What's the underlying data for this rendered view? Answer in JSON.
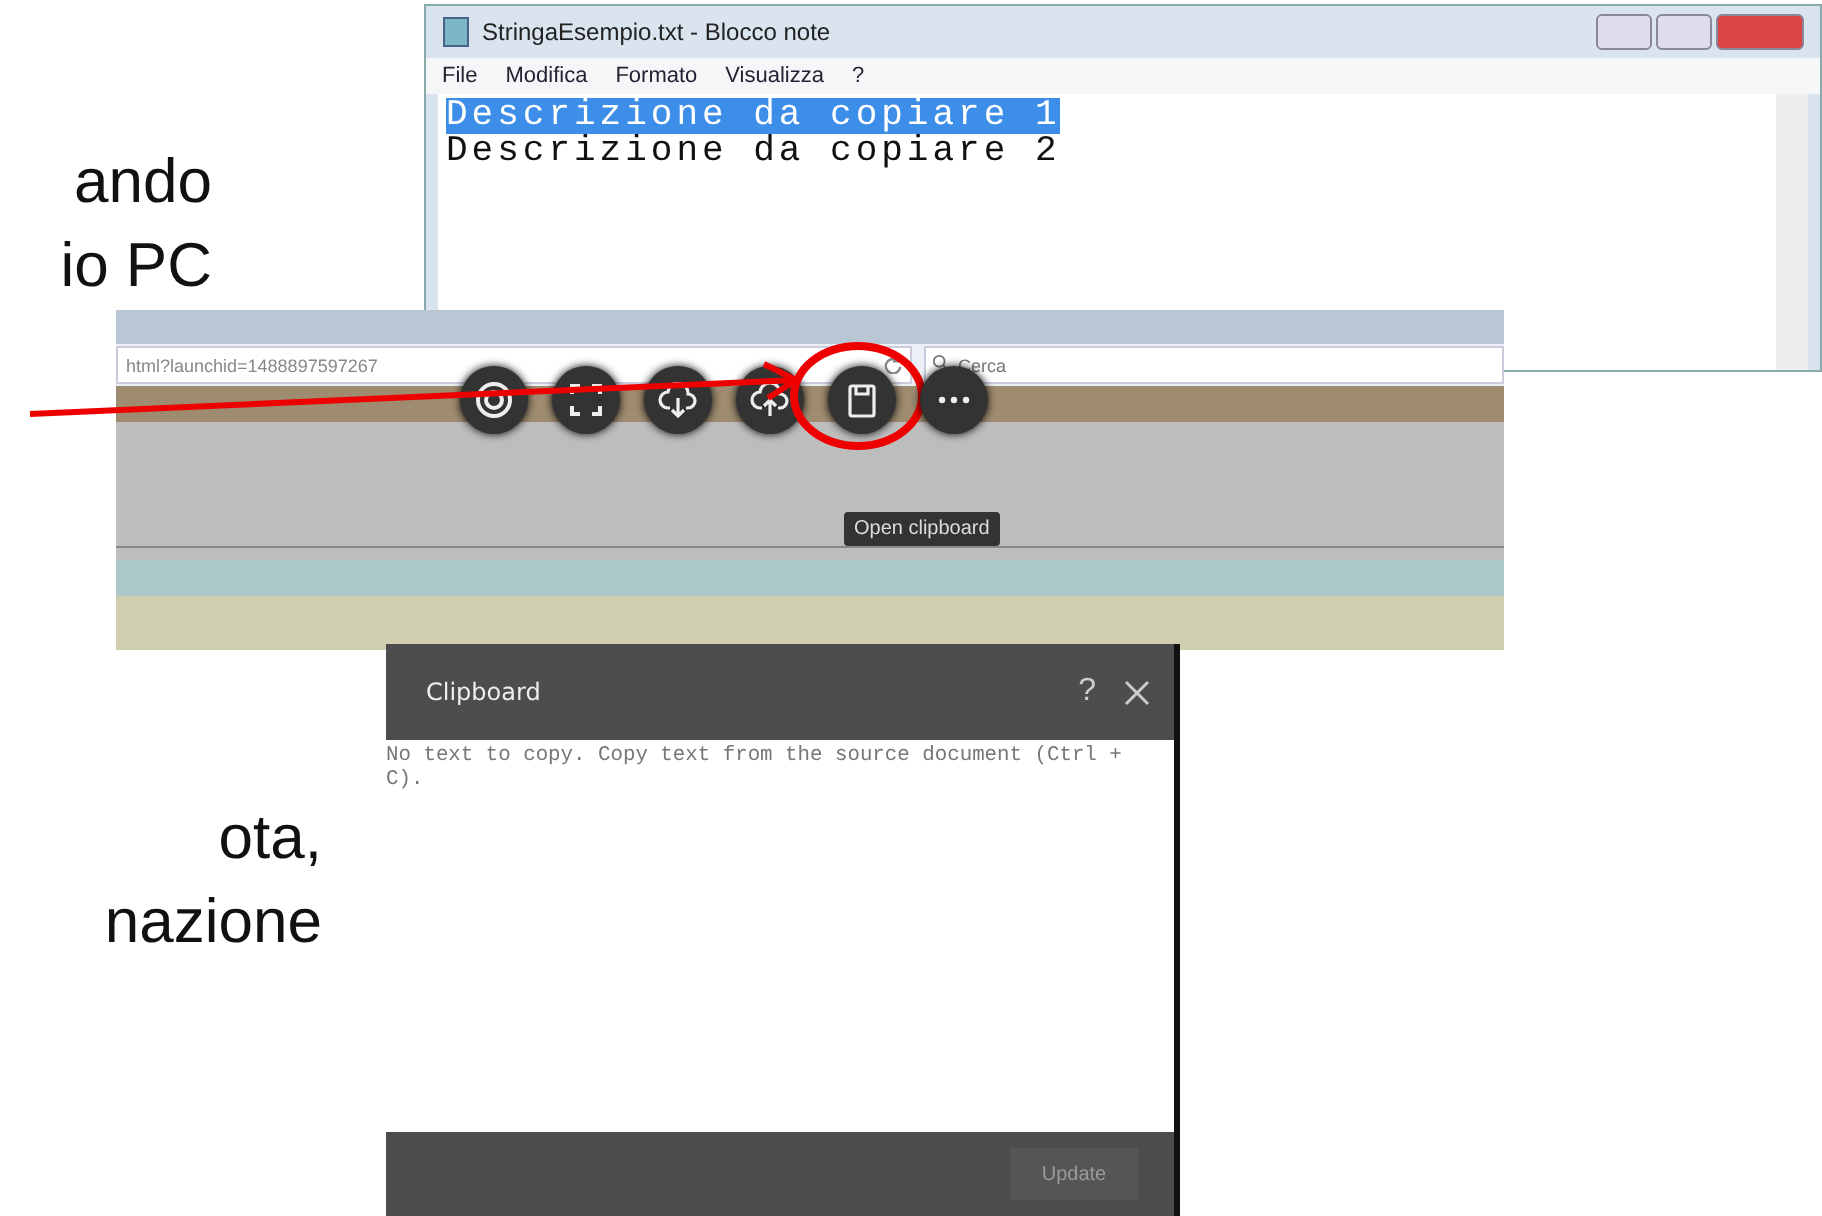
{
  "slide_text_top": [
    "ando",
    "io PC"
  ],
  "notepad": {
    "title": "StringaEsempio.txt - Blocco note",
    "menu": [
      "File",
      "Modifica",
      "Formato",
      "Visualizza",
      "?"
    ],
    "lines": [
      {
        "text": "Descrizione da copiare 1",
        "selected": true
      },
      {
        "text": "Descrizione da copiare 2",
        "selected": false
      }
    ]
  },
  "browser": {
    "url": "html?launchid=1488897597267",
    "search": {
      "placeholder": "Cerca"
    },
    "toolbar": [
      {
        "kind": "target",
        "highlighted": false
      },
      {
        "kind": "expand",
        "highlighted": false
      },
      {
        "kind": "download",
        "highlighted": false
      },
      {
        "kind": "upload",
        "highlighted": false
      },
      {
        "kind": "clipboard",
        "highlighted": true
      },
      {
        "kind": "more",
        "highlighted": false
      }
    ],
    "tooltip": "Open clipboard"
  },
  "slide_text_bottom": [
    "ota,",
    "nazione"
  ],
  "clipboard": {
    "title": "Clipboard",
    "help": "?",
    "text": {
      "placeholder": "No text to copy. Copy text from the source document (Ctrl + C)."
    },
    "button": {
      "label": "Update",
      "disabled": true
    }
  }
}
